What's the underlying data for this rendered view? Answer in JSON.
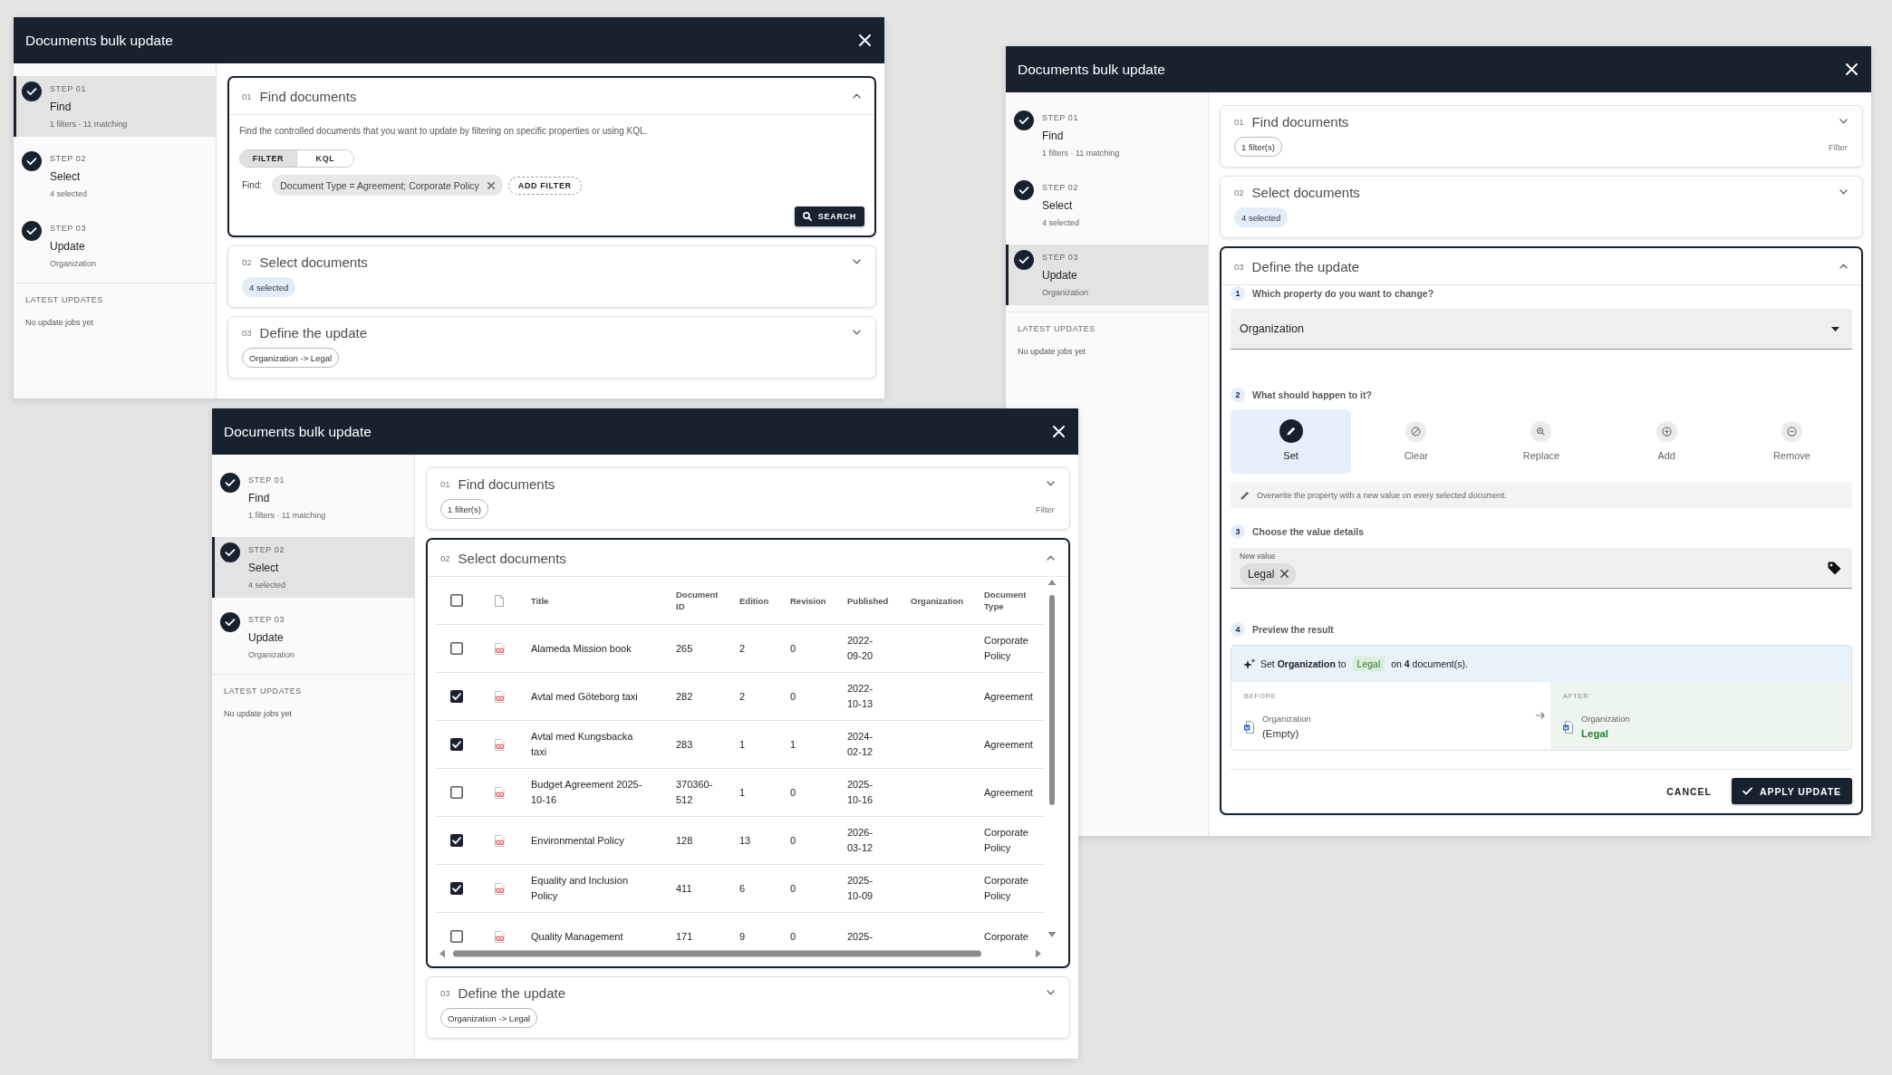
{
  "dialogs": [
    {
      "title": "Documents bulk update",
      "steps": [
        {
          "label": "STEP 01",
          "name": "Find",
          "detail": "1 filters · 11 matching",
          "done": true,
          "selected": true
        },
        {
          "label": "STEP 02",
          "name": "Select",
          "detail": "4 selected",
          "done": true,
          "selected": false
        },
        {
          "label": "STEP 03",
          "name": "Update",
          "detail": "Organization",
          "done": true,
          "selected": false
        }
      ],
      "latest_updates": {
        "heading": "LATEST UPDATES",
        "text": "No update jobs yet"
      },
      "sections": [
        {
          "kind": "find",
          "number": "01",
          "title": "Find documents",
          "expanded": true,
          "description": "Find the controlled documents that you want to update by filtering on specific properties or using KQL.",
          "modes": [
            {
              "label": "FILTER",
              "selected": true
            },
            {
              "label": "KQL",
              "selected": false
            }
          ],
          "find_label": "Find:",
          "filters": [
            "Document Type = Agreement; Corporate Policy"
          ],
          "add_filter": "ADD FILTER",
          "search_button": "SEARCH"
        },
        {
          "kind": "select",
          "number": "02",
          "title": "Select documents",
          "expanded": false,
          "summary": "4 selected"
        },
        {
          "kind": "define",
          "number": "03",
          "title": "Define the update",
          "expanded": false,
          "summary": "Organization -> Legal"
        }
      ]
    },
    {
      "title": "Documents bulk update",
      "steps": [
        {
          "label": "STEP 01",
          "name": "Find",
          "detail": "1 filters · 11 matching",
          "done": true,
          "selected": false
        },
        {
          "label": "STEP 02",
          "name": "Select",
          "detail": "4 selected",
          "done": true,
          "selected": false
        },
        {
          "label": "STEP 03",
          "name": "Update",
          "detail": "Organization",
          "done": true,
          "selected": true
        }
      ],
      "latest_updates": {
        "heading": "LATEST UPDATES",
        "text": "No update jobs yet"
      },
      "sections": [
        {
          "kind": "find",
          "number": "01",
          "title": "Find documents",
          "expanded": false,
          "summary": "1 filter(s)",
          "note": "Filter"
        },
        {
          "kind": "select",
          "number": "02",
          "title": "Select documents",
          "expanded": false,
          "summary": "4 selected"
        },
        {
          "kind": "define",
          "number": "03",
          "title": "Define the update",
          "expanded": true,
          "questions": [
            {
              "kind": "property",
              "number": "1",
              "label": "Which property do you want to change?",
              "value": "Organization"
            },
            {
              "kind": "action",
              "number": "2",
              "label": "What should happen to it?",
              "options": [
                {
                  "label": "Set",
                  "selected": true
                },
                {
                  "label": "Clear",
                  "selected": false
                },
                {
                  "label": "Replace",
                  "selected": false
                },
                {
                  "label": "Add",
                  "selected": false
                },
                {
                  "label": "Remove",
                  "selected": false
                }
              ],
              "hint": "Overwrite the property with a new value on every selected document."
            },
            {
              "kind": "value",
              "number": "3",
              "label": "Choose the value details",
              "field_label": "New value",
              "values": [
                "Legal"
              ]
            },
            {
              "kind": "preview",
              "number": "4",
              "label": "Preview the result",
              "sentence_start": "Set **Organization** to",
              "sentence_value": "Legal",
              "sentence_end": "on **4** document(s).",
              "before": {
                "heading": "BEFORE",
                "property": "Organization",
                "value": "(Empty)"
              },
              "after": {
                "heading": "AFTER",
                "property": "Organization",
                "value": "Legal"
              }
            }
          ],
          "cancel_button": "CANCEL",
          "apply_button": "APPLY UPDATE"
        }
      ]
    },
    {
      "title": "Documents bulk update",
      "steps": [
        {
          "label": "STEP 01",
          "name": "Find",
          "detail": "1 filters · 11 matching",
          "done": true,
          "selected": false
        },
        {
          "label": "STEP 02",
          "name": "Select",
          "detail": "4 selected",
          "done": true,
          "selected": true
        },
        {
          "label": "STEP 03",
          "name": "Update",
          "detail": "Organization",
          "done": true,
          "selected": false
        }
      ],
      "latest_updates": {
        "heading": "LATEST UPDATES",
        "text": "No update jobs yet"
      },
      "sections": [
        {
          "kind": "find",
          "number": "01",
          "title": "Find documents",
          "expanded": false,
          "summary": "1 filter(s)",
          "note": "Filter"
        },
        {
          "kind": "select",
          "number": "02",
          "title": "Select documents",
          "expanded": true,
          "table": {
            "select_all": {
              "checked": false
            },
            "columns": [
              "Title",
              "Document ID",
              "Edition",
              "Revision",
              "Published",
              "Organization",
              "Document Type"
            ],
            "rows": [
              {
                "checked": false,
                "title": "Alameda Mission book",
                "document_id": "265",
                "edition": "2",
                "revision": "0",
                "published": "2022-09-20",
                "document_type": "Corporate Policy"
              },
              {
                "checked": true,
                "title": "Avtal med Göteborg taxi",
                "document_id": "282",
                "edition": "2",
                "revision": "0",
                "published": "2022-10-13",
                "document_type": "Agreement"
              },
              {
                "checked": true,
                "title": "Avtal med Kungsbacka taxi",
                "document_id": "283",
                "edition": "1",
                "revision": "1",
                "published": "2024-02-12",
                "document_type": "Agreement"
              },
              {
                "checked": false,
                "title": "Budget Agreement 2025-10-16",
                "document_id": "370360-512",
                "edition": "1",
                "revision": "0",
                "published": "2025-10-16",
                "document_type": "Agreement"
              },
              {
                "checked": true,
                "title": "Environmental Policy",
                "document_id": "128",
                "edition": "13",
                "revision": "0",
                "published": "2026-03-12",
                "document_type": "Corporate Policy"
              },
              {
                "checked": true,
                "title": "Equality and Inclusion Policy",
                "document_id": "411",
                "edition": "6",
                "revision": "0",
                "published": "2025-10-09",
                "document_type": "Corporate Policy"
              },
              {
                "checked": false,
                "title": "Quality Management",
                "document_id": "171",
                "edition": "9",
                "revision": "0",
                "published": "2025-",
                "document_type": "Corporate"
              }
            ]
          }
        },
        {
          "kind": "define",
          "number": "03",
          "title": "Define the update",
          "expanded": false,
          "summary": "Organization -> Legal"
        }
      ]
    }
  ]
}
